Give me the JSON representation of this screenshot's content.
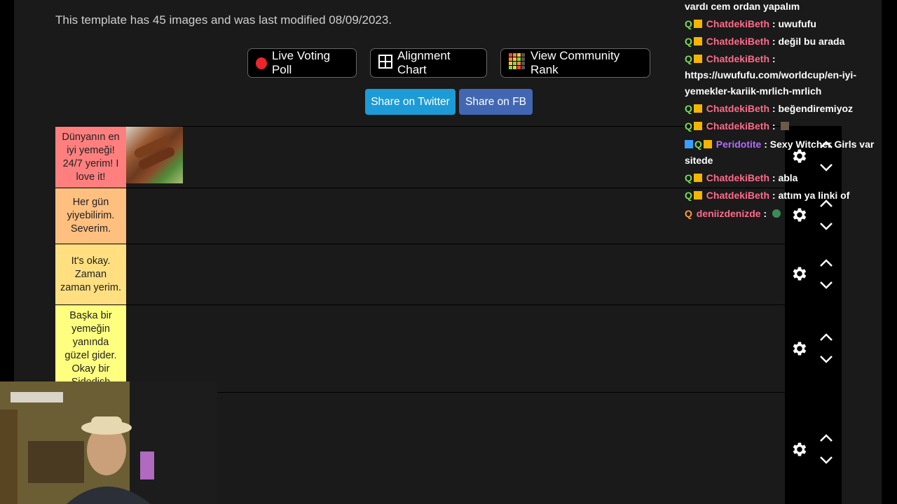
{
  "meta_text": "This template has 45 images and was last modified 08/09/2023.",
  "buttons": {
    "live_voting": "Live Voting Poll",
    "alignment": "Alignment Chart",
    "community_rank": "View Community Rank",
    "share_twitter": "Share on Twitter",
    "share_fb": "Share on FB"
  },
  "tiers": [
    {
      "label": "Dünyanın en iyi yemeği! 24/7 yerim! I love it!",
      "color": "#ff7f7f"
    },
    {
      "label": "Her gün yiyebilirim. Severim.",
      "color": "#ffbf7f"
    },
    {
      "label": "It's okay. Zaman zaman yerim.",
      "color": "#ffdf7f"
    },
    {
      "label": "Başka bir yemeğin yanında güzel gider. Okay bir Sidedish",
      "color": "#ffff7f"
    }
  ],
  "chat": [
    {
      "user": "",
      "text": "vardı cem ordan yapalım",
      "badges": "none"
    },
    {
      "user": "ChatdekiBeth",
      "text": " : uwufufu",
      "badges": "q-crown"
    },
    {
      "user": "ChatdekiBeth",
      "text": " : değil bu arada",
      "badges": "q-crown"
    },
    {
      "user": "ChatdekiBeth",
      "text": " :",
      "badges": "q-crown"
    },
    {
      "user": "",
      "text": "https://uwufufu.com/worldcup/en-iyi-",
      "badges": "none"
    },
    {
      "user": "",
      "text": "yemekler-kariik-mrlich-mrlich",
      "badges": "none"
    },
    {
      "user": "ChatdekiBeth",
      "text": " : beğendiremiyoz",
      "badges": "q-crown"
    },
    {
      "user": "ChatdekiBeth",
      "text": " :",
      "badges": "q-crown"
    },
    {
      "user": "Peridotite",
      "text": " : Sexy Witcher Girls var",
      "badges": "x-q-crown"
    },
    {
      "user": "",
      "text": "sitede",
      "badges": "none"
    },
    {
      "user": "ChatdekiBeth",
      "text": " : abla",
      "badges": "q-crown"
    },
    {
      "user": "ChatdekiBeth",
      "text": " : attım ya linki of",
      "badges": "q-crown"
    },
    {
      "user": "deniizdenizde",
      "text": " :",
      "badges": "q"
    }
  ],
  "colors": {
    "twitter": "#1d9bd7",
    "fb": "#4267b2",
    "page_bg": "#1a1a1a"
  }
}
